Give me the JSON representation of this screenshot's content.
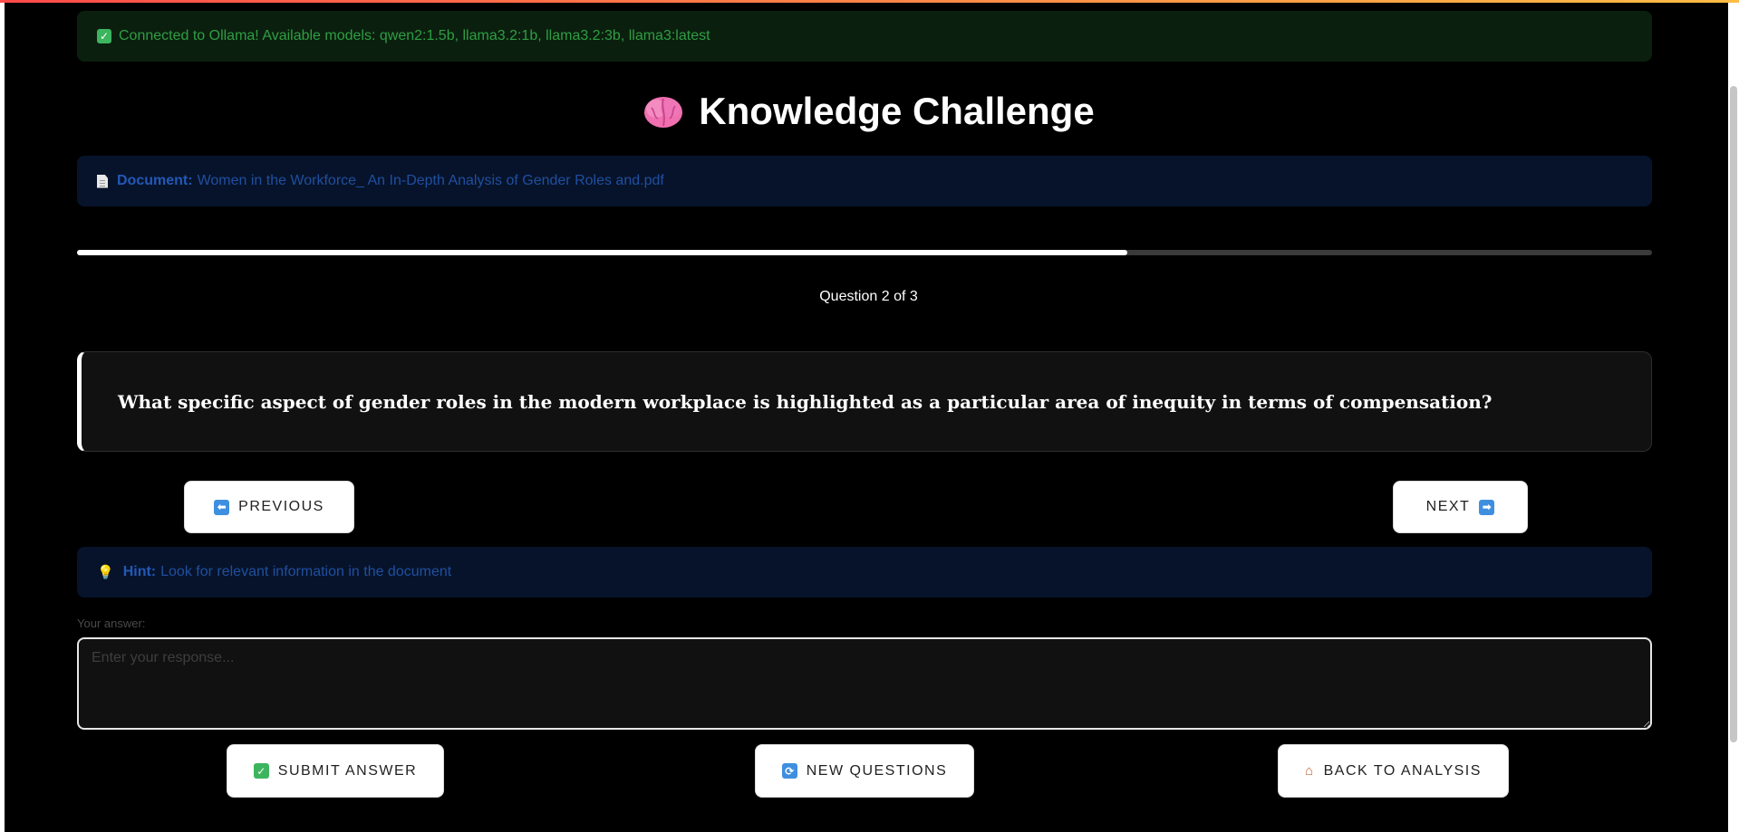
{
  "status": {
    "icon": "check-icon",
    "text": "Connected to Ollama! Available models: qwen2:1.5b, llama3.2:1b, llama3.2:3b, llama3:latest"
  },
  "header": {
    "icon": "brain-icon",
    "title": "Knowledge Challenge"
  },
  "document": {
    "icon": "document-icon",
    "label": "Document:",
    "name": "Women in the Workforce_ An In-Depth Analysis of Gender Roles and.pdf"
  },
  "progress": {
    "fraction": 0.667,
    "counter_text": "Question 2 of 3"
  },
  "question": {
    "text": "What specific aspect of gender roles in the modern workplace is highlighted as a particular area of inequity in terms of compensation?"
  },
  "nav": {
    "previous_label": "PREVIOUS",
    "previous_icon": "arrow-left-icon",
    "next_label": "NEXT",
    "next_icon": "arrow-right-icon"
  },
  "hint": {
    "icon": "lightbulb-icon",
    "label": "Hint:",
    "text": "Look for relevant information in the document"
  },
  "answer": {
    "label": "Your answer:",
    "value": "",
    "placeholder": "Enter your response..."
  },
  "actions": {
    "submit_label": "SUBMIT ANSWER",
    "submit_icon": "check-icon",
    "new_questions_label": "NEW QUESTIONS",
    "new_questions_icon": "refresh-icon",
    "back_label": "BACK TO ANALYSIS",
    "back_icon": "house-icon"
  },
  "colors": {
    "background": "#000000",
    "success_bg": "#0b1f0e",
    "success_text": "#2f9e44",
    "info_bg": "#07132a",
    "info_text": "#1f4fa0",
    "accent": "#ffffff"
  }
}
